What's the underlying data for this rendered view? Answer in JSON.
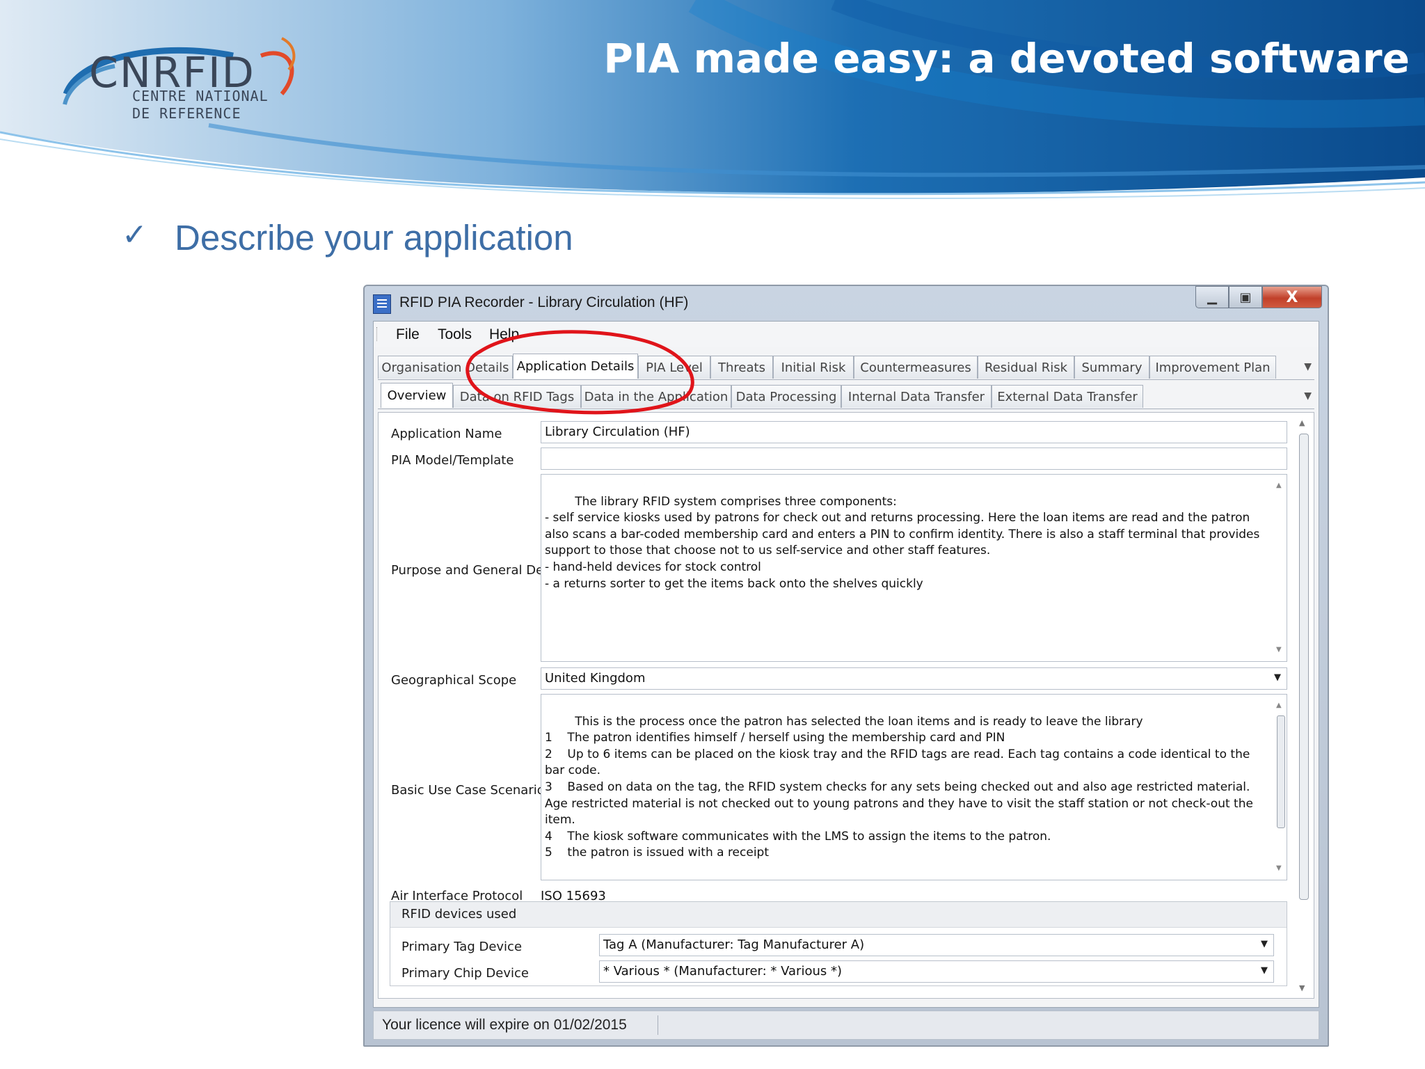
{
  "slide": {
    "logo": {
      "name": "CNRFID",
      "line1": "CENTRE NATIONAL",
      "line2": "DE REFERENCE"
    },
    "title": "PIA made easy: a devoted software",
    "bullet_icon": "checkmark-icon",
    "bullet_text": "Describe your application"
  },
  "window": {
    "title": "RFID PIA Recorder - Library Circulation (HF)",
    "icon": "app-document-icon",
    "controls": {
      "minimize": "minimize-icon",
      "maximize": "maximize-icon",
      "close": "X"
    },
    "menu": [
      "File",
      "Tools",
      "Help"
    ],
    "tabs_top": [
      "Organisation Details",
      "Application Details",
      "PIA Level",
      "Threats",
      "Initial Risk",
      "Countermeasures",
      "Residual Risk",
      "Summary",
      "Improvement Plan"
    ],
    "tabs_top_active": "Application Details",
    "tabs_sub": [
      "Overview",
      "Data on RFID Tags",
      "Data in the Application",
      "Data Processing",
      "Internal Data Transfer",
      "External Data Transfer"
    ],
    "tabs_sub_active": "Overview",
    "form": {
      "application_name": {
        "label": "Application Name",
        "value": "Library Circulation (HF)"
      },
      "pia_model": {
        "label": "PIA Model/Template",
        "value": ""
      },
      "purpose": {
        "label": "Purpose and General Description",
        "value": "The library RFID system comprises three components:\n- self service kiosks used by patrons for check out and returns processing. Here the loan items are read and the patron also scans a bar-coded membership card and enters a PIN to confirm identity. There is also a staff terminal that provides support to those that choose not to us self-service and other staff features.\n- hand-held devices for stock control\n- a returns sorter to get the items back onto the shelves quickly"
      },
      "geographical_scope": {
        "label": "Geographical Scope",
        "value": "United Kingdom"
      },
      "use_cases": {
        "label": "Basic Use Case Scenarios",
        "value": "This is the process once the patron has selected the loan items and is ready to leave the library\n1    The patron identifies himself / herself using the membership card and PIN\n2    Up to 6 items can be placed on the kiosk tray and the RFID tags are read. Each tag contains a code identical to the bar code.\n3    Based on data on the tag, the RFID system checks for any sets being checked out and also age restricted material. Age restricted material is not checked out to young patrons and they have to visit the staff station or not check-out the item.\n4    The kiosk software communicates with the LMS to assign the items to the patron.\n5    the patron is issued with a receipt\n\nIf a patron leaves without using the check-out facilities a security alarm is triggered."
      },
      "air_interface": {
        "label": "Air Interface Protocol",
        "value": "ISO 15693"
      },
      "devices": {
        "title": "RFID devices used",
        "primary_tag": {
          "label": "Primary Tag Device",
          "value": "Tag A (Manufacturer: Tag Manufacturer A)"
        },
        "primary_chip": {
          "label": "Primary Chip Device",
          "value": "* Various * (Manufacturer: * Various *)"
        }
      }
    },
    "status": "Your licence will expire on 01/02/2015"
  },
  "colors": {
    "banner_blue": "#1a6fb5",
    "bullet_blue": "#3e6ea6",
    "annotation_red": "#e0141a"
  }
}
